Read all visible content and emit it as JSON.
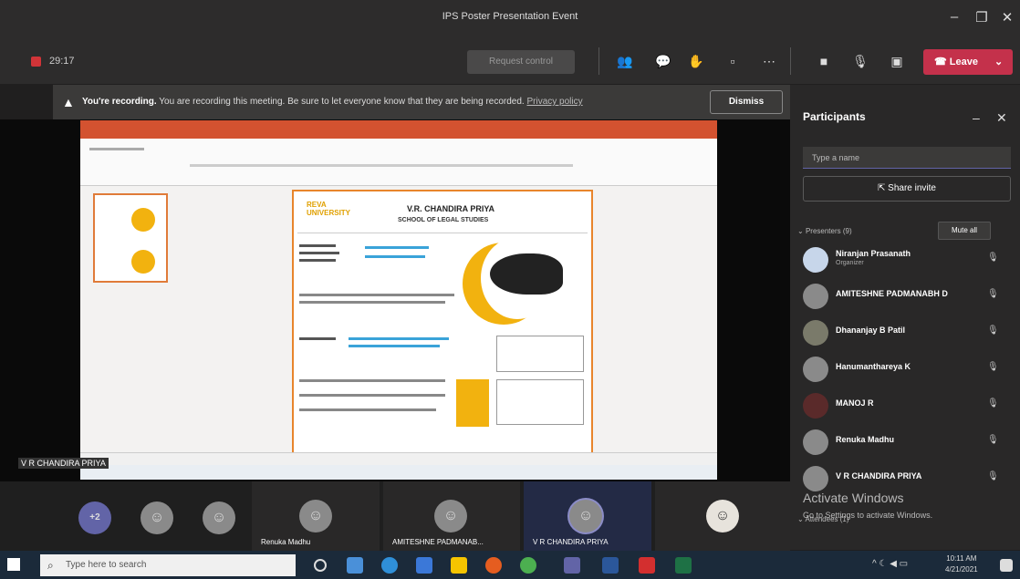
{
  "window": {
    "title": "IPS Poster Presentation Event"
  },
  "toolbar": {
    "timer": "29:17",
    "stage_button": "Request control",
    "leave_label": "Leave"
  },
  "banner": {
    "lead": "You're recording.",
    "text": "You are recording this meeting. Be sure to let everyone know that they are being recorded.",
    "link": "Privacy policy",
    "dismiss": "Dismiss"
  },
  "slide": {
    "name": "V.R. CHANDIRA PRIYA",
    "school": "SCHOOL OF LEGAL STUDIES",
    "logo": "REVA UNIVERSITY"
  },
  "speaker_tag": "V R CHANDIRA PRIYA",
  "gallery": {
    "overflow": "+2",
    "tiles": [
      {
        "name": "Renuka Madhu"
      },
      {
        "name": "AMITESHNE PADMANAB..."
      },
      {
        "name": "V R CHANDIRA PRIYA"
      }
    ]
  },
  "participants": {
    "title": "Participants",
    "search_placeholder": "Type a name",
    "share_invite": "Share invite",
    "presenters_label": "Presenters (9)",
    "mute_all": "Mute all",
    "people": [
      {
        "name": "Niranjan Prasanath",
        "role": "Organizer"
      },
      {
        "name": "AMITESHNE PADMANABH D"
      },
      {
        "name": "Dhananjay B Patil"
      },
      {
        "name": "Hanumanthareya K"
      },
      {
        "name": "MANOJ R"
      },
      {
        "name": "Renuka Madhu"
      },
      {
        "name": "V R CHANDIRA PRIYA"
      }
    ],
    "attendees_label": "Attendees (1)"
  },
  "watermark": {
    "line1": "Activate Windows",
    "line2": "Go to Settings to activate Windows."
  },
  "taskbar": {
    "search_placeholder": "Type here to search",
    "time": "10:11 AM",
    "date": "4/21/2021"
  }
}
